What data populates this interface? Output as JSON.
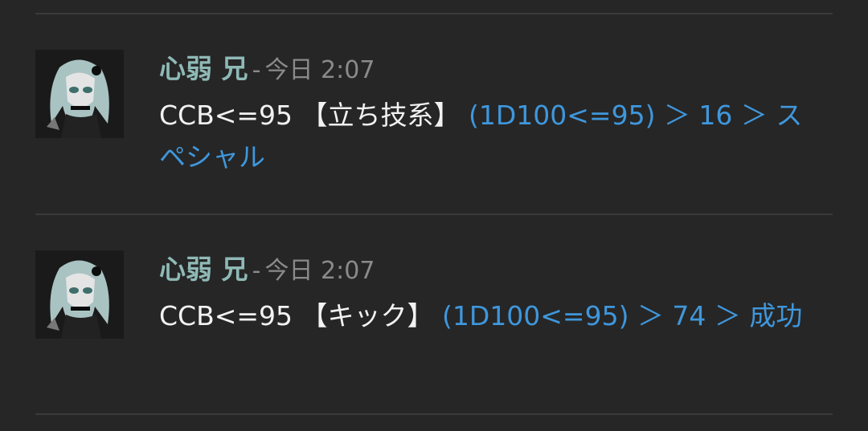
{
  "messages": [
    {
      "author": "心弱 兄",
      "separator": "-",
      "time": "今日 2:07",
      "command": "CCB<=95 【立ち技系】",
      "result": "(1D100<=95) ＞ 16 ＞ スペシャル",
      "avatar_icon": "avatar-anime-girl"
    },
    {
      "author": "心弱 兄",
      "separator": "-",
      "time": "今日 2:07",
      "command": "CCB<=95 【キック】",
      "result": "(1D100<=95) ＞ 74 ＞ 成功",
      "avatar_icon": "avatar-anime-girl"
    }
  ],
  "colors": {
    "background": "#262626",
    "author": "#8fb9b6",
    "timestamp": "#8a8a8a",
    "command_text": "#f2f2f2",
    "result_text": "#3f97dc",
    "divider": "#3a3a3a"
  }
}
